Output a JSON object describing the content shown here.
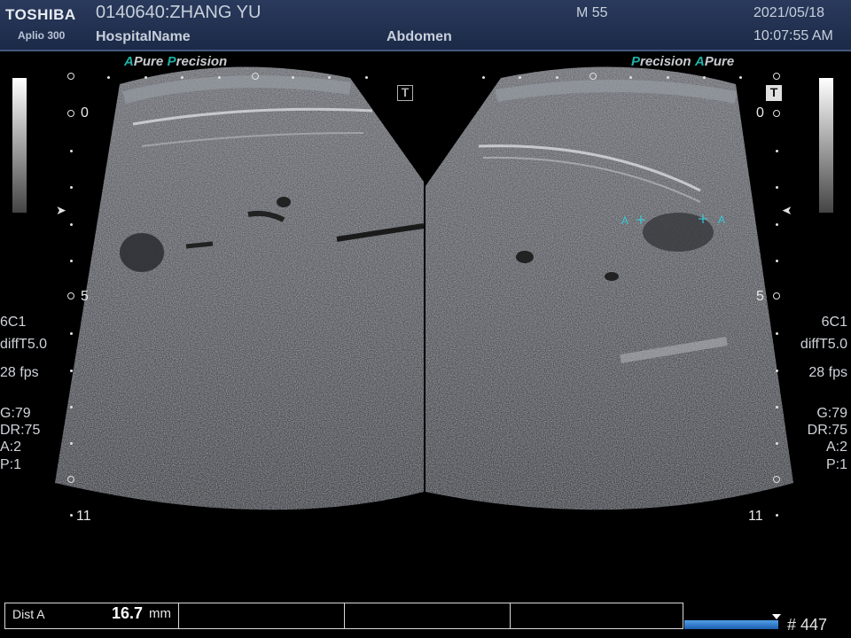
{
  "header": {
    "brand": "TOSHIBA",
    "model": "Aplio 300",
    "patient_id": "0140640:ZHANG YU",
    "hospital": "HospitalName",
    "sex_age": "M 55",
    "exam": "Abdomen",
    "date": "2021/05/18",
    "time": "10:07:55 AM"
  },
  "logos": {
    "left": {
      "a": "A",
      "pure": "Pure",
      "p": "P",
      "recision": "recision"
    },
    "right": {
      "p": "P",
      "recision": "recision",
      "a": "A",
      "pure": "Pure"
    }
  },
  "left_params": {
    "probe": "6C1",
    "mode": "diffT5.0",
    "fps": "28 fps",
    "gain": "G:79",
    "dr": "DR:75",
    "a": "A:2",
    "p": "P:1"
  },
  "right_params": {
    "probe": "6C1",
    "mode": "diffT5.0",
    "fps": "28 fps",
    "gain": "G:79",
    "dr": "DR:75",
    "a": "A:2",
    "p": "P:1"
  },
  "depth_scale": {
    "top": "0",
    "mid": "5",
    "bottom": "11"
  },
  "t_icon_label": "T",
  "calipers": {
    "start": "A",
    "end": "A"
  },
  "measurement": {
    "label": "Dist A",
    "value": "16.7",
    "unit": "mm"
  },
  "frame_count": "# 447",
  "colors": {
    "header_bg": "#1c2a48",
    "accent_teal": "#1fb3a8",
    "caliper": "#3cc9d6",
    "cine_bar": "#1e5fb0"
  }
}
